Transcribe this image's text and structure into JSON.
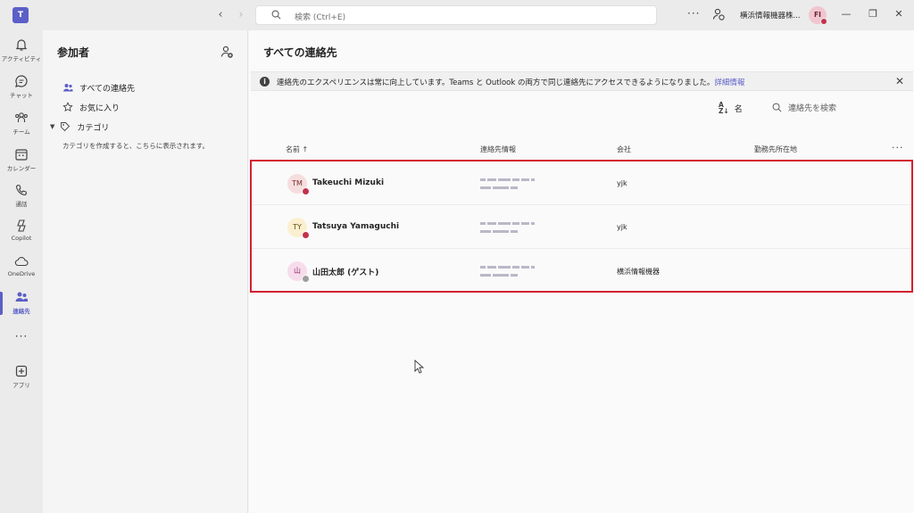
{
  "titlebar": {
    "app_logo": "T",
    "search_placeholder": "検索 (Ctrl+E)",
    "more": "···",
    "org_name": "横浜情報機器株...",
    "avatar_initials": "FI",
    "presence_color": "#c4314b",
    "minimize": "—",
    "restore": "❐",
    "close": "✕"
  },
  "rail": {
    "accent": "#5b5fc7",
    "items": [
      {
        "label": "アクティビティ",
        "icon": "bell-icon"
      },
      {
        "label": "チャット",
        "icon": "chat-icon"
      },
      {
        "label": "チーム",
        "icon": "teams-icon"
      },
      {
        "label": "カレンダー",
        "icon": "calendar-icon"
      },
      {
        "label": "通話",
        "icon": "phone-icon"
      },
      {
        "label": "Copilot",
        "icon": "copilot-icon"
      },
      {
        "label": "OneDrive",
        "icon": "cloud-icon"
      },
      {
        "label": "連絡先",
        "icon": "people-icon",
        "active": true
      },
      {
        "label": "アプリ",
        "icon": "add-app-icon"
      }
    ],
    "more": "···"
  },
  "side": {
    "title": "参加者",
    "items": [
      {
        "label": "すべての連絡先",
        "icon": "people-icon"
      },
      {
        "label": "お気に入り",
        "icon": "star-icon"
      },
      {
        "label": "カテゴリ",
        "icon": "tag-icon"
      }
    ],
    "category_hint": "カテゴリを作成すると、こちらに表示されます。"
  },
  "main": {
    "title": "すべての連絡先",
    "banner": {
      "message": "連絡先のエクスペリエンスは常に向上しています。Teams と Outlook の両方で同じ連絡先にアクセスできるようになりました。",
      "link": "詳細情報"
    },
    "sort_label": "名",
    "contact_search_placeholder": "連絡先を検索",
    "columns": {
      "name": "名前 ↑",
      "contact_info": "連絡先情報",
      "company": "会社",
      "location": "勤務先所在地"
    },
    "highlight_color": "#d2202f",
    "contacts": [
      {
        "initials": "TM",
        "name": "Takeuchi Mizuki",
        "company": "yjk",
        "avatar_bg": "#f6dede",
        "avatar_fg": "#7a2e2e",
        "status_color": "#c4314b"
      },
      {
        "initials": "TY",
        "name": "Tatsuya Yamaguchi",
        "company": "yjk",
        "avatar_bg": "#fbefcf",
        "avatar_fg": "#6b4f0c",
        "status_color": "#c4314b"
      },
      {
        "initials": "山",
        "name": "山田太郎 (ゲスト)",
        "company": "横浜情報機器",
        "avatar_bg": "#f7dcec",
        "avatar_fg": "#8a2f64",
        "status_color": "#9e9e9e"
      }
    ]
  }
}
